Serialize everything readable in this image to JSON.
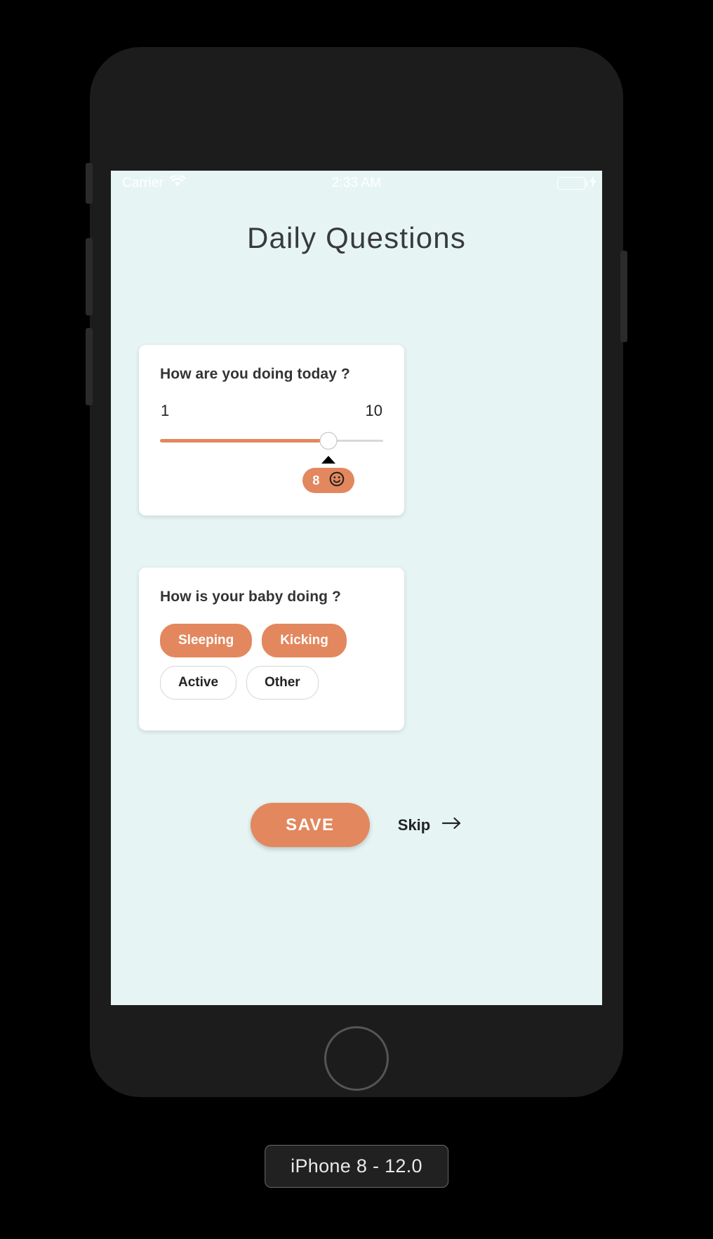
{
  "simulator": {
    "device_label": "iPhone 8 - 12.0"
  },
  "status_bar": {
    "carrier": "Carrier",
    "wifi_icon": "wifi-icon",
    "time": "2:33 AM",
    "battery_icon": "battery-icon",
    "charging_icon": "lightning-bolt-icon",
    "battery_color": "#6fcf79"
  },
  "app": {
    "title": "Daily Questions",
    "background_color": "#e6f5f4",
    "accent_color": "#e3875e"
  },
  "mood_card": {
    "question": "How are you doing today ?",
    "scale_min_label": "1",
    "scale_max_label": "10",
    "value": 8,
    "value_text": "8",
    "emoji_icon": "smiley-face-icon",
    "fill_percent": 75.6
  },
  "baby_card": {
    "question": "How is your baby doing ?",
    "options": [
      {
        "label": "Sleeping",
        "selected": true
      },
      {
        "label": "Kicking",
        "selected": true
      },
      {
        "label": "Active",
        "selected": false
      },
      {
        "label": "Other",
        "selected": false
      }
    ]
  },
  "actions": {
    "save_label": "SAVE",
    "skip_label": "Skip",
    "skip_arrow_icon": "arrow-right-icon"
  }
}
